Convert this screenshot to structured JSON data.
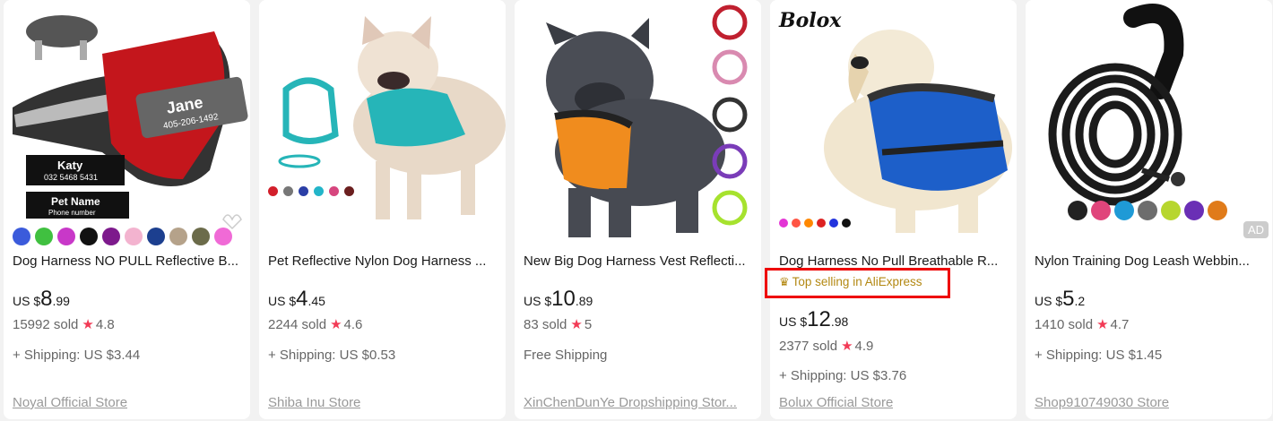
{
  "products": [
    {
      "title": "Dog Harness NO PULL Reflective B...",
      "price_currency": "US $",
      "price_int": "8",
      "price_dec": ".99",
      "sold": "15992 sold",
      "rating": "4.8",
      "shipping": "+ Shipping: US $3.44",
      "store": "Noyal Official Store",
      "image_text": [
        "Jane",
        "405-206-1492",
        "Katy",
        "032 5468 5431",
        "Pet Name",
        "Phone number"
      ],
      "swatches": [
        "#3b5bdb",
        "#40c040",
        "#c838c8",
        "#111111",
        "#7d1a8c",
        "#f3b3cf",
        "#1c3f8f",
        "#b5a28a",
        "#6b6b4a",
        "#f06ad6"
      ]
    },
    {
      "title": "Pet Reflective Nylon Dog Harness ...",
      "price_currency": "US $",
      "price_int": "4",
      "price_dec": ".45",
      "sold": "2244 sold",
      "rating": "4.6",
      "shipping": "+ Shipping: US $0.53",
      "store": "Shiba Inu Store",
      "swatches": [
        "#d21f2b",
        "#777777",
        "#2b3fa6",
        "#23b5c9",
        "#d6467e",
        "#6b1f1f"
      ]
    },
    {
      "title": "New Big Dog Harness Vest Reflecti...",
      "price_currency": "US $",
      "price_int": "10",
      "price_dec": ".89",
      "sold": "83 sold",
      "rating": "5",
      "shipping": "Free Shipping",
      "store": "XinChenDunYe Dropshipping Stor..."
    },
    {
      "title": "Dog Harness No Pull Breathable R...",
      "badge": "Top selling in AliExpress",
      "price_currency": "US $",
      "price_int": "12",
      "price_dec": ".98",
      "sold": "2377 sold",
      "rating": "4.9",
      "shipping": "+ Shipping: US $3.76",
      "store": "Bolux Official Store",
      "brand_logo": "Bolox",
      "swatches": [
        "#e335d5",
        "#ff5544",
        "#ff8800",
        "#dd2222",
        "#2233dd",
        "#111111"
      ]
    },
    {
      "title": "Nylon Training Dog Leash Webbin...",
      "price_currency": "US $",
      "price_int": "5",
      "price_dec": ".2",
      "sold": "1410 sold",
      "rating": "4.7",
      "shipping": "+ Shipping: US $1.45",
      "store": "Shop910749030 Store",
      "ad_label": "AD",
      "swatches": [
        "#222222",
        "#e0457b",
        "#1f9ad6",
        "#6d6d6d",
        "#b7d62e",
        "#6a2fb5",
        "#e07b1a"
      ]
    }
  ],
  "star_icon": "star-icon",
  "crown_icon": "crown-icon"
}
